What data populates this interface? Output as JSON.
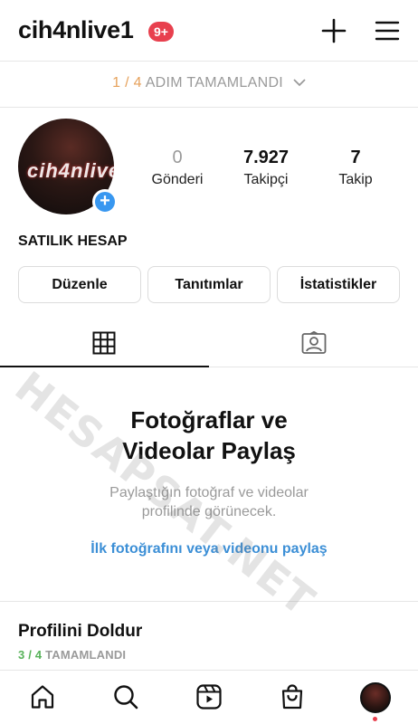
{
  "header": {
    "username": "cih4nlive1",
    "notification_badge": "9+",
    "plus_icon": "plus-icon",
    "menu_icon": "hamburger-menu-icon"
  },
  "steps_banner": {
    "progress": "1 / 4",
    "label": "ADIM TAMAMLANDI"
  },
  "profile": {
    "avatar_text": "cih4nlive",
    "stats": [
      {
        "value": "0",
        "label": "Gönderi"
      },
      {
        "value": "7.927",
        "label": "Takipçi"
      },
      {
        "value": "7",
        "label": "Takip"
      }
    ],
    "display_name": "SATILIK HESAP",
    "buttons": [
      "Düzenle",
      "Tanıtımlar",
      "İstatistikler"
    ]
  },
  "tabs": [
    {
      "icon": "grid-icon",
      "active": true
    },
    {
      "icon": "tagged-person-icon",
      "active": false
    }
  ],
  "empty_state": {
    "title_line1": "Fotoğraflar ve",
    "title_line2": "Videolar Paylaş",
    "subtitle_line1": "Paylaştığın fotoğraf ve videolar",
    "subtitle_line2": "profilinde görünecek.",
    "link": "İlk fotoğrafını veya videonu paylaş"
  },
  "complete_profile": {
    "title": "Profilini Doldur",
    "progress": "3 / 4",
    "label": "TAMAMLANDI"
  },
  "bottom_nav": [
    "home-icon",
    "search-icon",
    "reels-icon",
    "shop-icon",
    "profile-avatar"
  ],
  "watermark": "HESAPSAT.NET",
  "colors": {
    "accent_blue": "#3897f0",
    "link_blue": "#3c8fd6",
    "badge_red": "#e8404e",
    "step_orange": "#e6a15b",
    "progress_green": "#58b25a"
  }
}
